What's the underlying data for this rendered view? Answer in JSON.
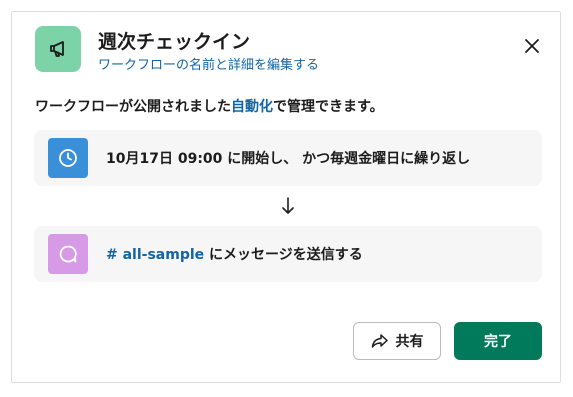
{
  "dialog": {
    "title": "週次チェックイン",
    "edit_link": "ワークフローの名前と詳細を編集する",
    "close_icon": "close-icon",
    "header_icon": "megaphone-icon",
    "header_icon_bg": "#7dd3a8"
  },
  "description": {
    "prefix": "ワークフローが公開されました",
    "link": "自動化",
    "suffix": "で管理できます。"
  },
  "steps": [
    {
      "icon": "clock-icon",
      "icon_bg": "#3a8fd9",
      "text": "10月17日 09:00 に開始し、 かつ毎週金曜日に繰り返し"
    },
    {
      "icon": "message-icon",
      "icon_bg": "#d69ae6",
      "channel": "# all-sample",
      "text": " にメッセージを送信する"
    }
  ],
  "footer": {
    "share_label": "共有",
    "share_icon": "share-arrow-icon",
    "done_label": "完了",
    "done_color": "#007a5a"
  }
}
